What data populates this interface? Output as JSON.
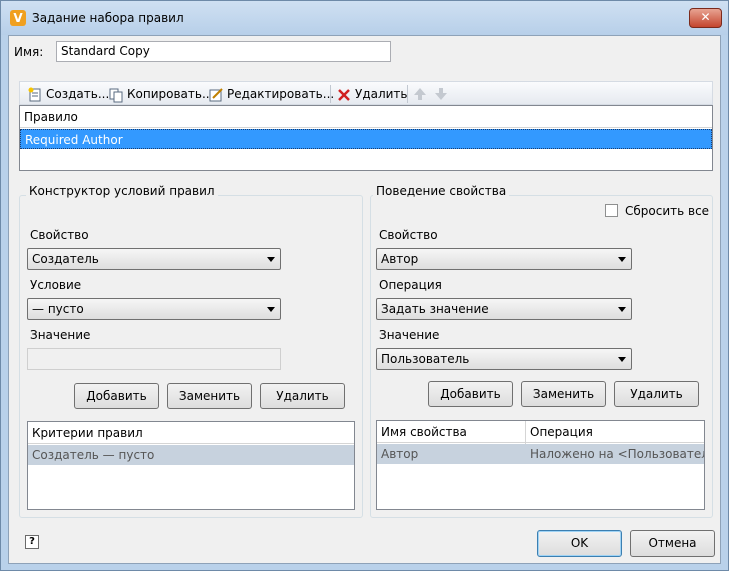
{
  "window": {
    "title": "Задание набора правил",
    "app_icon_letter": "V",
    "close_glyph": "✕"
  },
  "name_field": {
    "label": "Имя:",
    "value": "Standard Copy"
  },
  "toolbar": {
    "create_label": "Создать...",
    "copy_label": "Копировать...",
    "edit_label": "Редактировать...",
    "delete_label": "Удалить",
    "up_icon": "arrow-up-icon",
    "down_icon": "arrow-down-icon"
  },
  "rules_grid": {
    "header": "Правило",
    "rows": [
      "Required Author"
    ]
  },
  "condition_builder": {
    "title": "Конструктор условий правил",
    "property_label": "Свойство",
    "property_value": "Создатель",
    "condition_label": "Условие",
    "condition_value": "— пусто",
    "value_label": "Значение",
    "value_value": "",
    "add_label": "Добавить",
    "replace_label": "Заменить",
    "delete_label": "Удалить",
    "criteria_header": "Критерии правил",
    "criteria_rows": [
      "Создатель — пусто"
    ]
  },
  "property_behavior": {
    "title": "Поведение свойства",
    "reset_all_label": "Сбросить все",
    "reset_all_checked": false,
    "property_label": "Свойство",
    "property_value": "Автор",
    "operation_label": "Операция",
    "operation_value": "Задать значение",
    "value_label": "Значение",
    "value_value": "Пользователь",
    "add_label": "Добавить",
    "replace_label": "Заменить",
    "delete_label": "Удалить",
    "columns": [
      "Имя свойства",
      "Операция"
    ],
    "rows": [
      [
        "Автор",
        "Наложено на <Пользователь>"
      ]
    ]
  },
  "footer": {
    "help_glyph": "?",
    "ok_label": "OK",
    "cancel_label": "Отмена"
  },
  "colors": {
    "selection_blue": "#3399ff",
    "selection_gray": "#c7d2de",
    "window_frame": "#b9d1ea"
  }
}
